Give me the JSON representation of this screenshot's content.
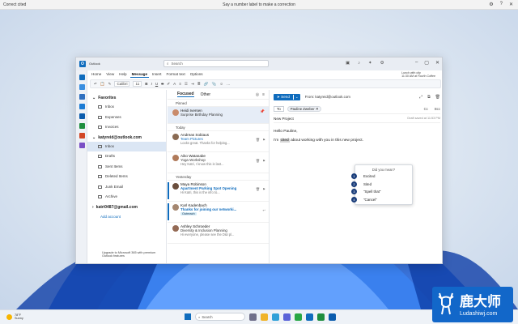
{
  "voice_bar": {
    "left_text": "Correct cited",
    "center_text": "Say a number label to make a correction",
    "icons": [
      "gear-icon",
      "help-icon",
      "close-icon"
    ]
  },
  "outlook": {
    "app_name": "Outlook",
    "search_placeholder": "Search",
    "ribbon_tabs": [
      "Home",
      "View",
      "Help",
      "Message",
      "Insert",
      "Format text",
      "Options"
    ],
    "active_tab": "Message",
    "font_name": "Calibri",
    "font_size": "11",
    "weather_line1": "Lunch with city",
    "weather_line2": "11:30 AM at Fourth Coffee",
    "folders": {
      "favorites_header": "Favorites",
      "favorites": [
        "Inbox",
        "Expenses",
        "Invoices"
      ],
      "account1": "katyreid@outlook.com",
      "account1_folders": [
        "Inbox",
        "Drafts",
        "Sent Items",
        "Deleted Items",
        "Junk Email",
        "Archive"
      ],
      "account2": "katri0487@gmail.com",
      "add_account": "Add account",
      "upgrade_text": "Upgrade to Microsoft 365 with premium Outlook features"
    },
    "list": {
      "tab_focused": "Focused",
      "tab_other": "Other",
      "group_pinned": "Pinned",
      "group_today": "Today",
      "group_yesterday": "Yesterday",
      "messages_pinned": [
        {
          "sender": "Heidi Iversen",
          "subject": "Surprise Birthday Planning",
          "preview": ""
        }
      ],
      "messages_today": [
        {
          "sender": "Andreas Sobiaus",
          "subject": "Team Pictures",
          "preview": "Looks great. Thanks for helping..."
        },
        {
          "sender": "Aiko Watanabe",
          "subject": "Yoga Workshop",
          "preview": "Hey Katri, I know this is last..."
        }
      ],
      "messages_yesterday": [
        {
          "sender": "Maya Robinson",
          "subject": "Apartment Parking Spot Opening",
          "preview": "Hi Katri, this is the info to..."
        },
        {
          "sender": "Karl Kadenbach",
          "subject": "Thanks for joining our networki...",
          "preview": "Outreach",
          "tag": "Outreach"
        },
        {
          "sender": "Ashley Schroeder",
          "subject": "Diversity & Inclusion Planning",
          "preview": "Hi everyone, please see the D&I pl..."
        }
      ]
    },
    "compose": {
      "send_label": "Send",
      "from_label": "From: katyreid@outlook.com",
      "to_label": "To",
      "recipient": "Pauline Zweber",
      "cc_label": "Cc",
      "bcc_label": "Bcc",
      "subject": "New Project",
      "draft_saved": "Draft saved at 11:53 PM",
      "greeting": "Hello Pauline,",
      "body_before": "I'm",
      "body_highlight": "cited",
      "body_after": "about working with you in this new project.",
      "suggestion_question": "Did you mean?",
      "suggestions": [
        {
          "num": "1",
          "text": "Excited"
        },
        {
          "num": "2",
          "text": "Sited"
        },
        {
          "num": "3",
          "text": "\"Spell that\""
        },
        {
          "num": "4",
          "text": "\"Cancel\""
        }
      ]
    }
  },
  "taskbar": {
    "temp": "78°F",
    "condition": "Sunny",
    "search_placeholder": "Search"
  },
  "watermark": {
    "cn_text": "鹿大师",
    "url": "Ludashiwj.com"
  },
  "colors": {
    "accent": "#0f6cbd",
    "selected": "#dbe6f4"
  }
}
